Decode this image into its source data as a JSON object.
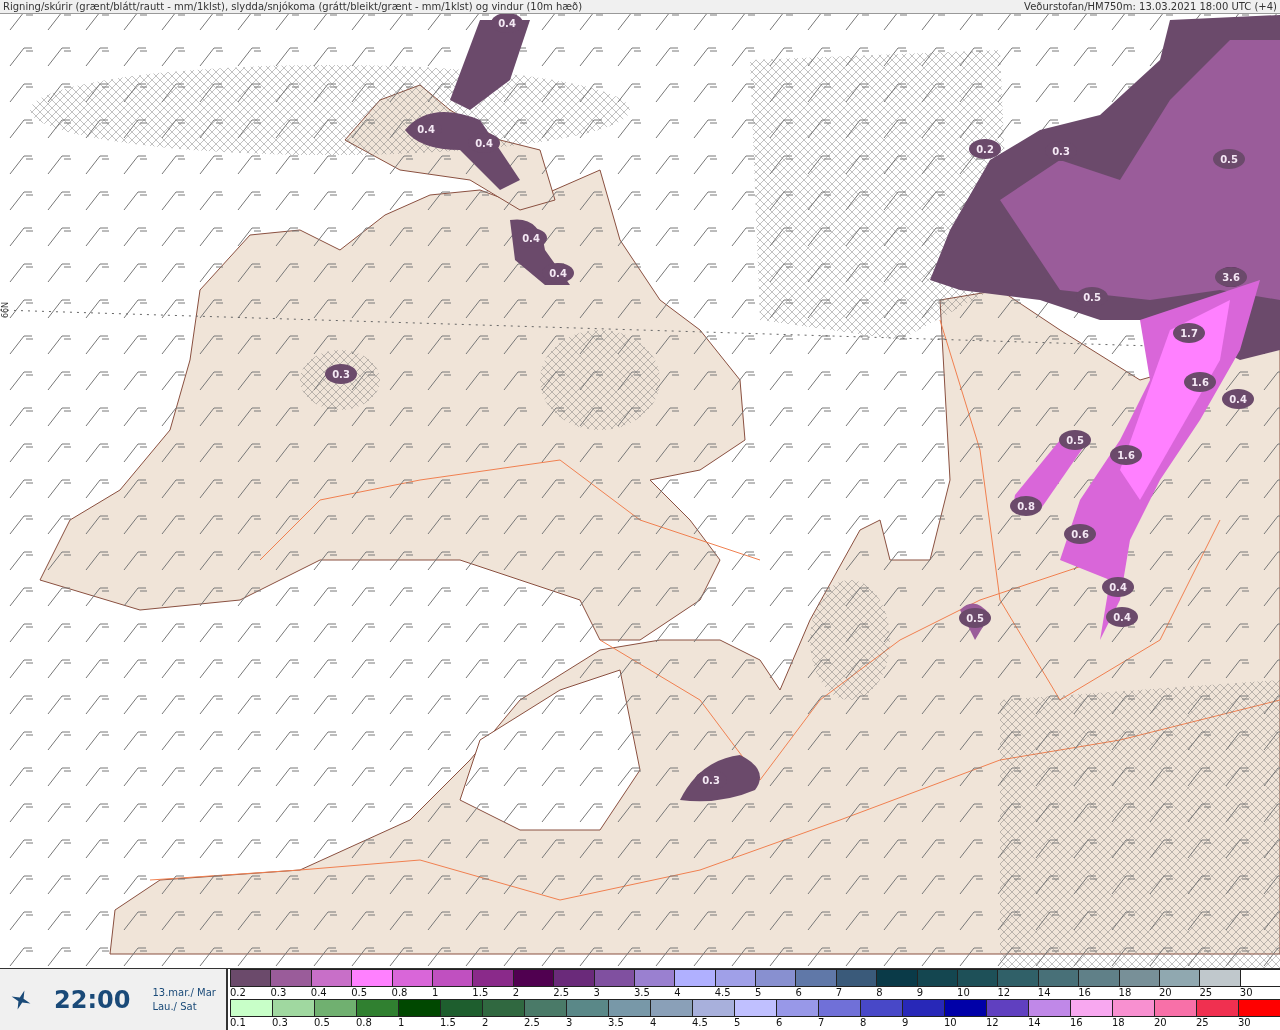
{
  "header": {
    "title": "Rigning/skúrir (grænt/blátt/rautt - mm/1klst), slydda/snjókoma (grátt/bleikt/grænt - mm/1klst) og vindur (10m hæð)",
    "source": "Veðurstofan/HM750m: 13.03.2021 18:00 UTC (+4)"
  },
  "map": {
    "latitude_label": "66N",
    "precip_labels": [
      "0.4",
      "0.4",
      "0.4",
      "0.4",
      "0.4",
      "0.3",
      "0.2",
      "0.3",
      "0.5",
      "0.5",
      "3.6",
      "1.7",
      "1.6",
      "0.4",
      "0.5",
      "1.6",
      "0.8",
      "0.6",
      "0.4",
      "0.4",
      "0.5",
      "0.3"
    ]
  },
  "time_panel": {
    "time": "22:00",
    "date": "13.mar./ Mar",
    "day": "Lau./ Sat"
  },
  "legends": [
    {
      "items": [
        {
          "label": "0.2",
          "color": "#6b4a6b"
        },
        {
          "label": "0.3",
          "color": "#9a5c9a"
        },
        {
          "label": "0.4",
          "color": "#c86fc8"
        },
        {
          "label": "0.5",
          "color": "#ff80ff"
        },
        {
          "label": "0.8",
          "color": "#d966d9"
        },
        {
          "label": "1",
          "color": "#c050c0"
        },
        {
          "label": "1.5",
          "color": "#8a2a8a"
        },
        {
          "label": "2",
          "color": "#500050"
        },
        {
          "label": "2.5",
          "color": "#6a2a7a"
        },
        {
          "label": "3",
          "color": "#8050a0"
        },
        {
          "label": "3.5",
          "color": "#9a80d0"
        },
        {
          "label": "4",
          "color": "#b0b0ff"
        },
        {
          "label": "4.5",
          "color": "#a0a0e8"
        },
        {
          "label": "5",
          "color": "#8890d0"
        },
        {
          "label": "6",
          "color": "#6078a8"
        },
        {
          "label": "7",
          "color": "#3a5a7a"
        },
        {
          "label": "8",
          "color": "#0a3a48"
        },
        {
          "label": "9",
          "color": "#144650"
        },
        {
          "label": "10",
          "color": "#1e5058"
        },
        {
          "label": "12",
          "color": "#306068"
        },
        {
          "label": "14",
          "color": "#487078"
        },
        {
          "label": "16",
          "color": "#608088"
        },
        {
          "label": "18",
          "color": "#789098"
        },
        {
          "label": "20",
          "color": "#90a8b0"
        },
        {
          "label": "25",
          "color": "#c0c8cc"
        },
        {
          "label": "30",
          "color": "#ffffff"
        }
      ]
    },
    {
      "items": [
        {
          "label": "0.1",
          "color": "#c8ffc8"
        },
        {
          "label": "0.3",
          "color": "#a0d8a0"
        },
        {
          "label": "0.5",
          "color": "#70b070"
        },
        {
          "label": "0.8",
          "color": "#308030"
        },
        {
          "label": "1",
          "color": "#004800"
        },
        {
          "label": "1.5",
          "color": "#1e5e2e"
        },
        {
          "label": "2",
          "color": "#306840"
        },
        {
          "label": "2.5",
          "color": "#4a7a68"
        },
        {
          "label": "3",
          "color": "#5a8888"
        },
        {
          "label": "3.5",
          "color": "#7898a8"
        },
        {
          "label": "4",
          "color": "#8aa0b8"
        },
        {
          "label": "4.5",
          "color": "#a8b0dc"
        },
        {
          "label": "5",
          "color": "#c0c0ff"
        },
        {
          "label": "6",
          "color": "#9898e8"
        },
        {
          "label": "7",
          "color": "#7070d8"
        },
        {
          "label": "8",
          "color": "#4848c8"
        },
        {
          "label": "9",
          "color": "#2828b8"
        },
        {
          "label": "10",
          "color": "#0000a8"
        },
        {
          "label": "12",
          "color": "#6040c0"
        },
        {
          "label": "14",
          "color": "#c088e8"
        },
        {
          "label": "16",
          "color": "#f8a8f0"
        },
        {
          "label": "18",
          "color": "#f890d0"
        },
        {
          "label": "20",
          "color": "#f870a8"
        },
        {
          "label": "25",
          "color": "#f03050"
        },
        {
          "label": "30",
          "color": "#ff0000"
        }
      ]
    }
  ]
}
